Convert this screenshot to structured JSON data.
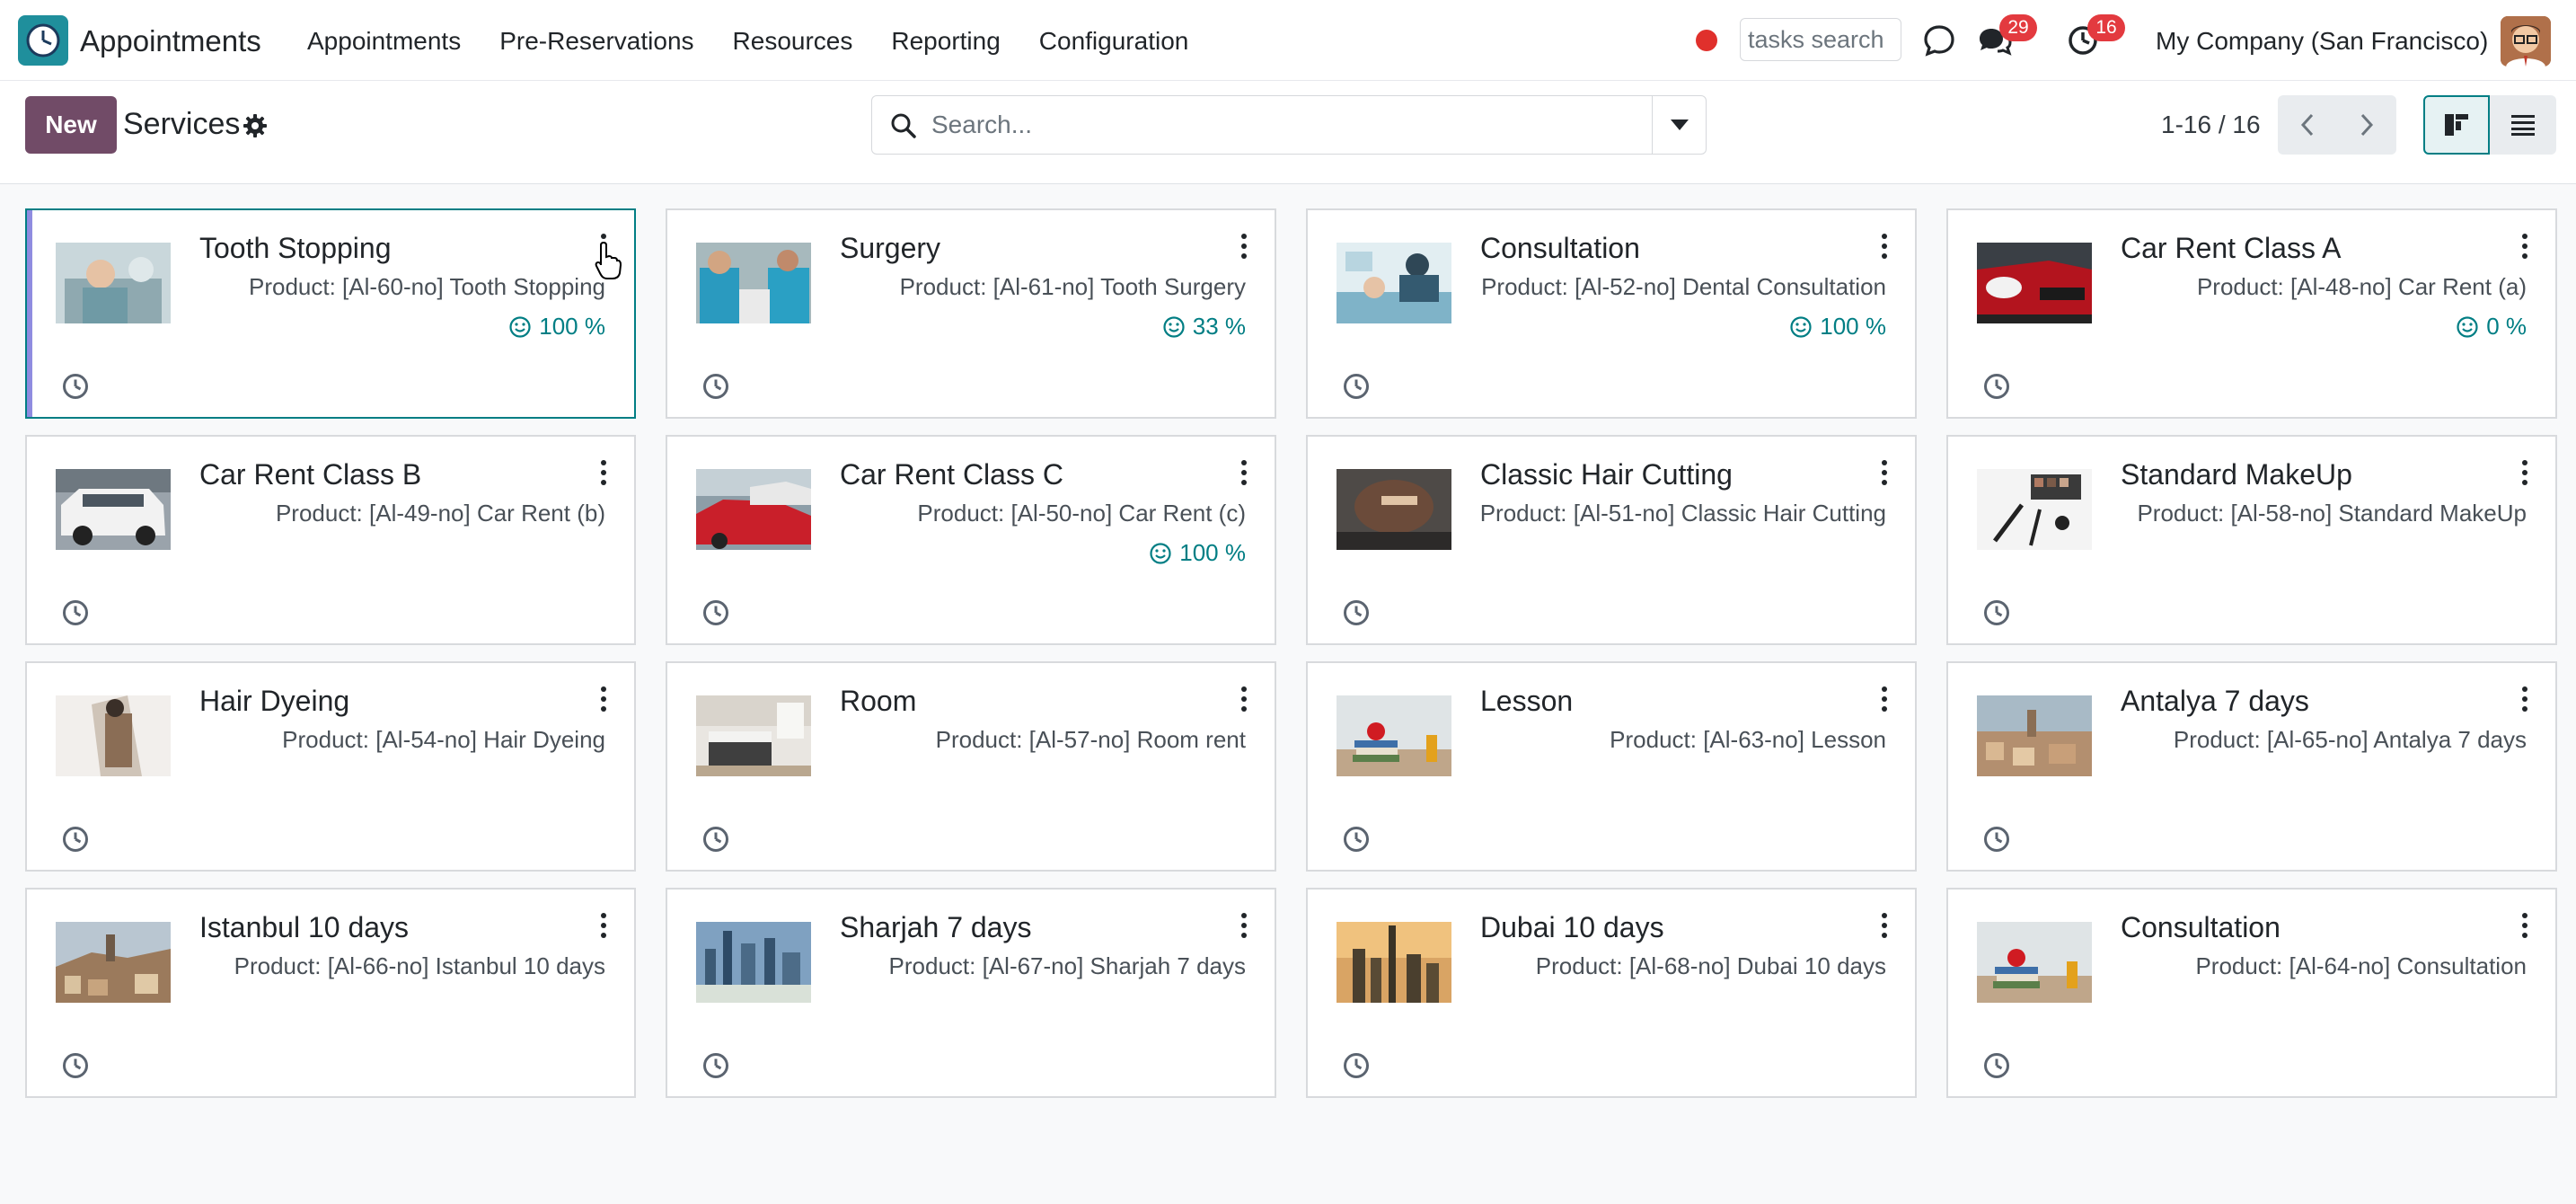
{
  "navbar": {
    "app_name": "Appointments",
    "app_icon": "clock-logo-icon",
    "menu": [
      "Appointments",
      "Pre-Reservations",
      "Resources",
      "Reporting",
      "Configuration"
    ],
    "tasks_search_value": "tasks search",
    "messages_badge": "29",
    "activities_badge": "16",
    "company": "My Company (San Francisco)",
    "record_color": "#e0302c"
  },
  "control_panel": {
    "new_label": "New",
    "title": "Services",
    "search_placeholder": "Search...",
    "pager": "1-16 / 16",
    "active_view": "kanban"
  },
  "cards": [
    {
      "title": "Tooth Stopping",
      "product": "Product: [Al-60-no] Tooth Stopping",
      "rating": "100 %",
      "image": "dental-patient"
    },
    {
      "title": "Surgery",
      "product": "Product: [Al-61-no] Tooth Surgery",
      "rating": "33 %",
      "image": "surgeons"
    },
    {
      "title": "Consultation",
      "product": "Product: [Al-52-no] Dental Consultation",
      "rating": "100 %",
      "image": "dentist-chair"
    },
    {
      "title": "Car Rent Class A",
      "product": "Product: [Al-48-no] Car Rent (a)",
      "rating": "0 %",
      "image": "red-car"
    },
    {
      "title": "Car Rent Class B",
      "product": "Product: [Al-49-no] Car Rent (b)",
      "rating": "",
      "image": "white-suv"
    },
    {
      "title": "Car Rent Class C",
      "product": "Product: [Al-50-no] Car Rent (c)",
      "rating": "100 %",
      "image": "parked-cars"
    },
    {
      "title": "Classic Hair Cutting",
      "product": "Product: [Al-51-no] Classic Hair Cutting",
      "rating": "",
      "image": "haircut"
    },
    {
      "title": "Standard MakeUp",
      "product": "Product: [Al-58-no] Standard MakeUp",
      "rating": "",
      "image": "makeup"
    },
    {
      "title": "Hair Dyeing",
      "product": "Product: [Al-54-no] Hair Dyeing",
      "rating": "",
      "image": "hair-dye"
    },
    {
      "title": "Room",
      "product": "Product: [Al-57-no] Room rent",
      "rating": "",
      "image": "bedroom"
    },
    {
      "title": "Lesson",
      "product": "Product: [Al-63-no] Lesson",
      "rating": "",
      "image": "books-apple"
    },
    {
      "title": "Antalya 7 days",
      "product": "Product: [Al-65-no] Antalya 7 days",
      "rating": "",
      "image": "city-coast"
    },
    {
      "title": "Istanbul 10 days",
      "product": "Product: [Al-66-no] Istanbul 10 days",
      "rating": "",
      "image": "city-hill"
    },
    {
      "title": "Sharjah 7 days",
      "product": "Product: [Al-67-no] Sharjah 7 days",
      "rating": "",
      "image": "skyline"
    },
    {
      "title": "Dubai 10 days",
      "product": "Product: [Al-68-no] Dubai 10 days",
      "rating": "",
      "image": "dubai-towers"
    },
    {
      "title": "Consultation",
      "product": "Product: [Al-64-no] Consultation",
      "rating": "",
      "image": "books-apple"
    }
  ]
}
